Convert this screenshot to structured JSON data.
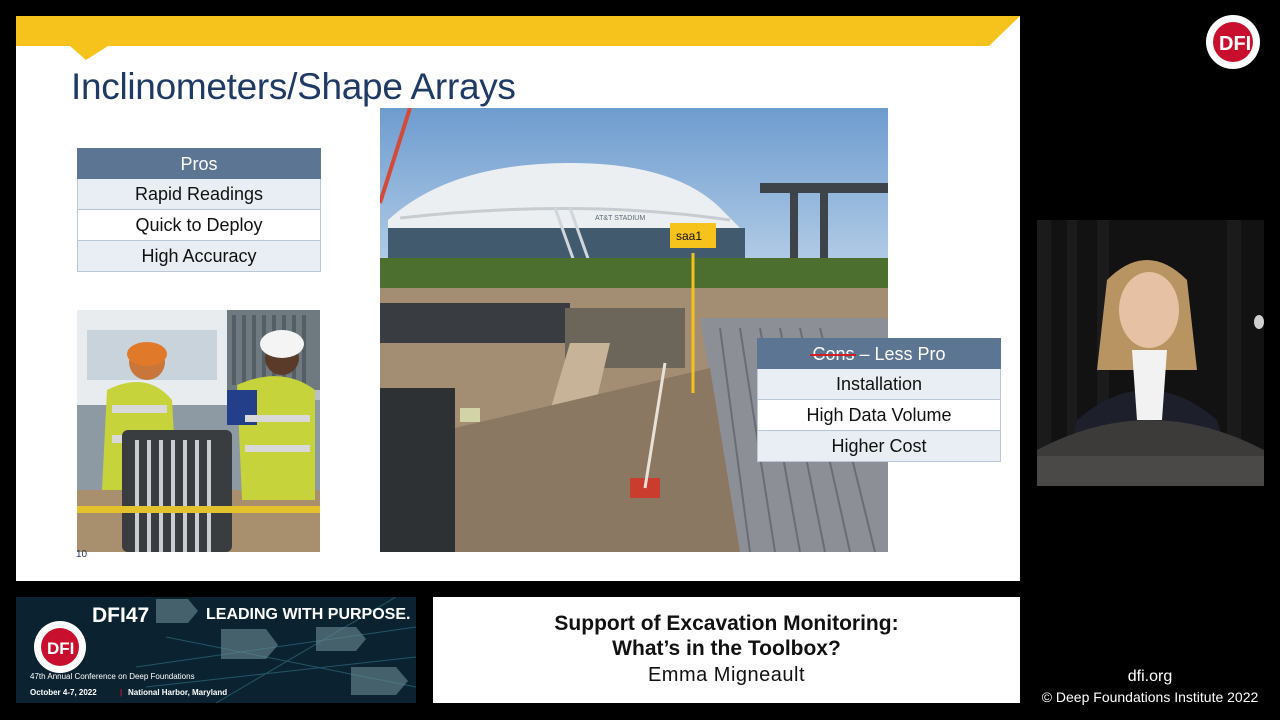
{
  "slide": {
    "title": "Inclinometers/Shape Arrays",
    "page_number": "10",
    "pros": {
      "header": "Pros",
      "items": [
        "Rapid Readings",
        "Quick to Deploy",
        "High Accuracy"
      ]
    },
    "cons": {
      "header_struck": "Cons",
      "header_rest": " – Less Pro",
      "items": [
        "Installation",
        "High Data Volume",
        "Higher Cost"
      ]
    },
    "site_photo": {
      "tag_label": "saa1",
      "stadium_sign": "AT&T STADIUM"
    }
  },
  "lower_third": {
    "event_code": "DFI47",
    "slogan": "LEADING WITH PURPOSE.",
    "org_arc": "DEEP FOUNDATIONS INSTITUTE",
    "logo_text": "DFI",
    "conference": "47th Annual Conference on Deep Foundations",
    "dates": "October 4-7, 2022",
    "location": "National Harbor, Maryland",
    "separator": "|"
  },
  "caption": {
    "title_line1": "Support of Excavation Monitoring:",
    "title_line2": "What’s in the Toolbox?",
    "presenter": "Emma Migneault"
  },
  "branding": {
    "corner_logo_text": "DFI",
    "corner_logo_arc": "DEEP FOUNDATIONS INSTITUTE",
    "url": "dfi.org",
    "copyright": "© Deep Foundations Institute 2022"
  },
  "colors": {
    "accent_yellow": "#f6c21c",
    "title_blue": "#1f3a64",
    "table_header": "#5b7593",
    "table_alt": "#e8eef3",
    "dfi_red": "#c8102e"
  }
}
